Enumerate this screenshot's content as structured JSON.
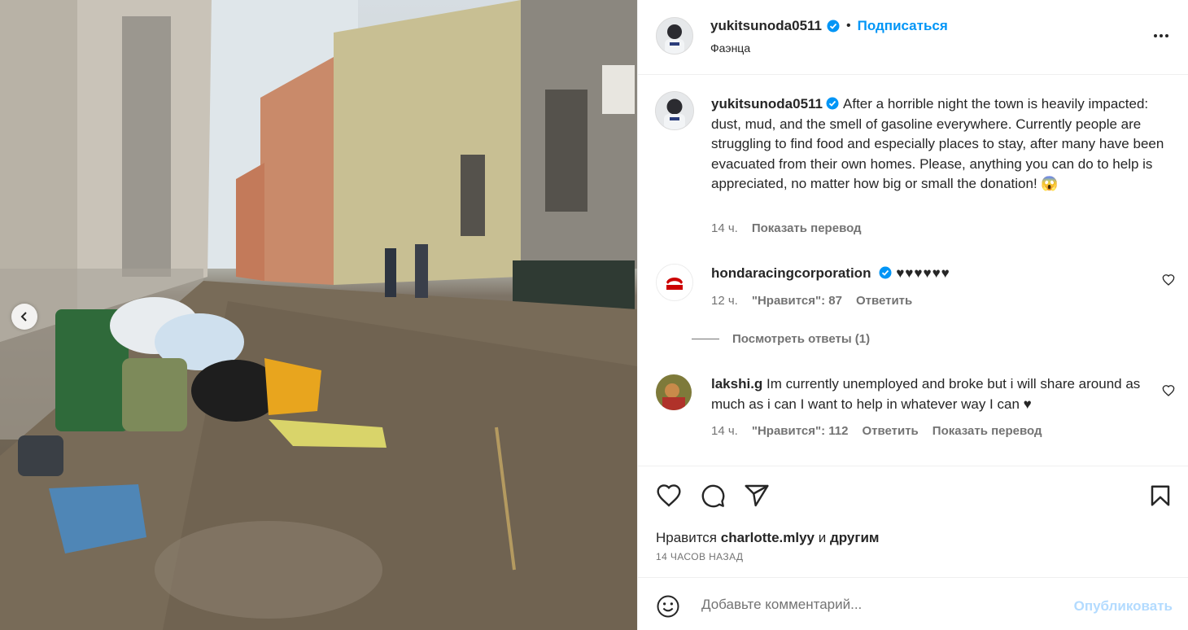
{
  "post": {
    "username": "yukitsunoda0511",
    "follow_label": "Подписаться",
    "location": "Фаэнца",
    "more_icon": "more-horizontal-icon",
    "caption": "After a horrible night the town is heavily impacted: dust, mud, and the smell of gasoline everywhere. Currently people are struggling to find food and especially places to stay, after many have been evacuated from their own homes. Please, anything you can do to help is appreciated, no matter how big or small the donation! 😱",
    "caption_time": "14 ч.",
    "translate_label": "Показать перевод"
  },
  "comments": [
    {
      "username": "hondaracingcorporation",
      "text": "♥♥♥♥♥♥",
      "time": "12 ч.",
      "likes": "\"Нравится\": 87",
      "reply_label": "Ответить",
      "view_replies": "Посмотреть ответы (1)"
    },
    {
      "username": "lakshi.g",
      "text": "Im currently unemployed and broke but i will share around as much as i can I want to help in whatever way I can ♥",
      "time": "14 ч.",
      "likes": "\"Нравится\": 112",
      "reply_label": "Ответить",
      "translate_label": "Показать перевод"
    }
  ],
  "likes": {
    "prefix": "Нравится",
    "user": "charlotte.mlyy",
    "and": "и",
    "others": "другим"
  },
  "time_ago": "14 ЧАСОВ НАЗАД",
  "add_comment": {
    "placeholder": "Добавьте комментарий...",
    "publish_label": "Опубликовать"
  },
  "colors": {
    "accent": "#0095f6",
    "publish_disabled": "#b3dbff",
    "secondary_text": "#737373",
    "honda_red": "#cc0000"
  }
}
